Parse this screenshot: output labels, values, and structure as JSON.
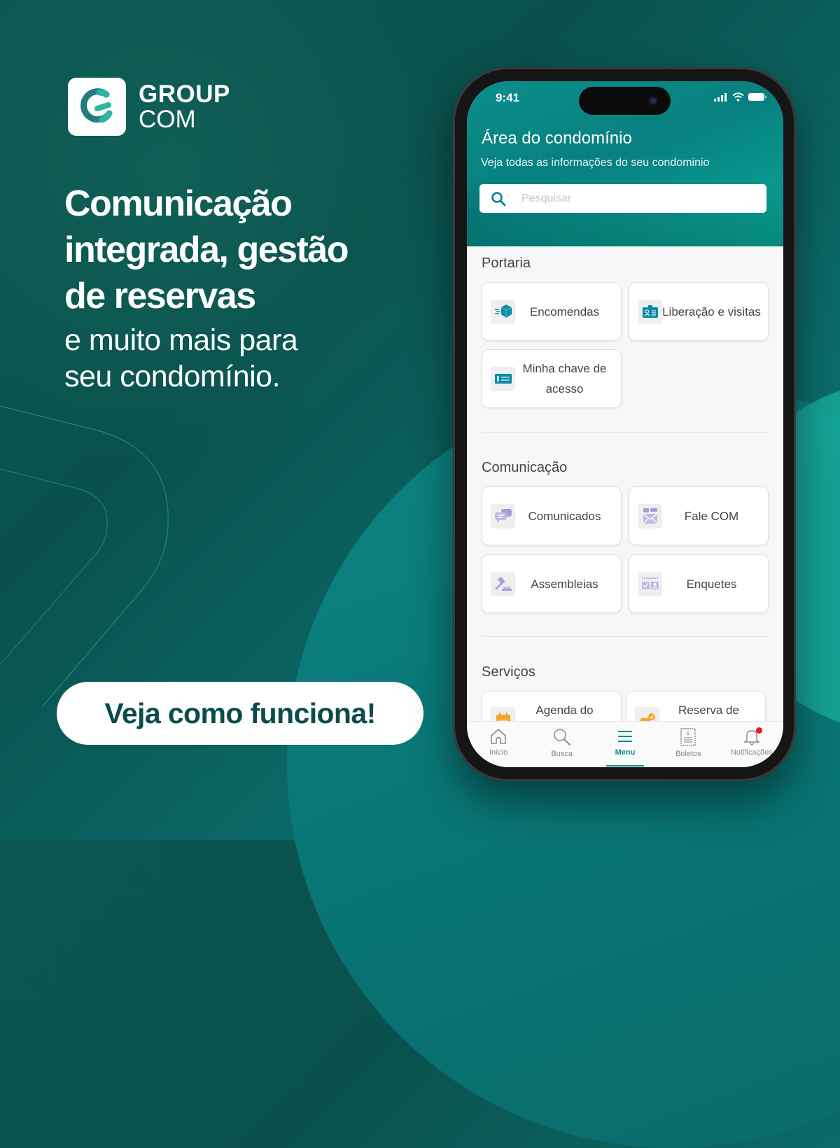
{
  "brand": {
    "line1": "GROUP",
    "line2": "COM"
  },
  "headline": {
    "bold_lines": [
      "Comunicação",
      "integrada, gestão",
      "de reservas"
    ],
    "regular_lines": [
      "e muito mais para",
      "seu condomínio."
    ]
  },
  "cta": {
    "label": "Veja como funciona!"
  },
  "colors": {
    "brand_teal": "#0a4d4c",
    "accent": "#0c8c8a",
    "notification_dot": "#e31b23"
  },
  "phone": {
    "status_bar": {
      "time": "9:41"
    },
    "header": {
      "title": "Área do condomínio",
      "subtitle": "Veja todas as informações do seu condominio",
      "search_placeholder": "Pesquisar"
    },
    "sections": [
      {
        "title": "Portaria",
        "items": [
          {
            "label": "Encomendas",
            "icon": "package-icon"
          },
          {
            "label": "Liberação e visitas",
            "icon": "visitor-badge-icon"
          },
          {
            "label": "Minha chave de acesso",
            "icon": "access-key-icon"
          }
        ]
      },
      {
        "title": "Comunicação",
        "items": [
          {
            "label": "Comunicados",
            "icon": "chat-bubbles-icon"
          },
          {
            "label": "Fale COM",
            "icon": "mail-message-icon"
          },
          {
            "label": "Assembleias",
            "icon": "gavel-icon"
          },
          {
            "label": "Enquetes",
            "icon": "poll-icon"
          }
        ]
      },
      {
        "title": "Serviços",
        "items": [
          {
            "label": "Agenda do",
            "icon": "calendar-icon"
          },
          {
            "label": "Reserva de",
            "icon": "reservation-icon"
          }
        ]
      }
    ],
    "tabbar": [
      {
        "label": "Início",
        "icon": "home-icon"
      },
      {
        "label": "Busca",
        "icon": "search-icon"
      },
      {
        "label": "Menu",
        "icon": "menu-icon",
        "active": true
      },
      {
        "label": "Boletos",
        "icon": "bill-icon"
      },
      {
        "label": "Notificações",
        "icon": "bell-icon",
        "has_badge": true
      }
    ]
  }
}
